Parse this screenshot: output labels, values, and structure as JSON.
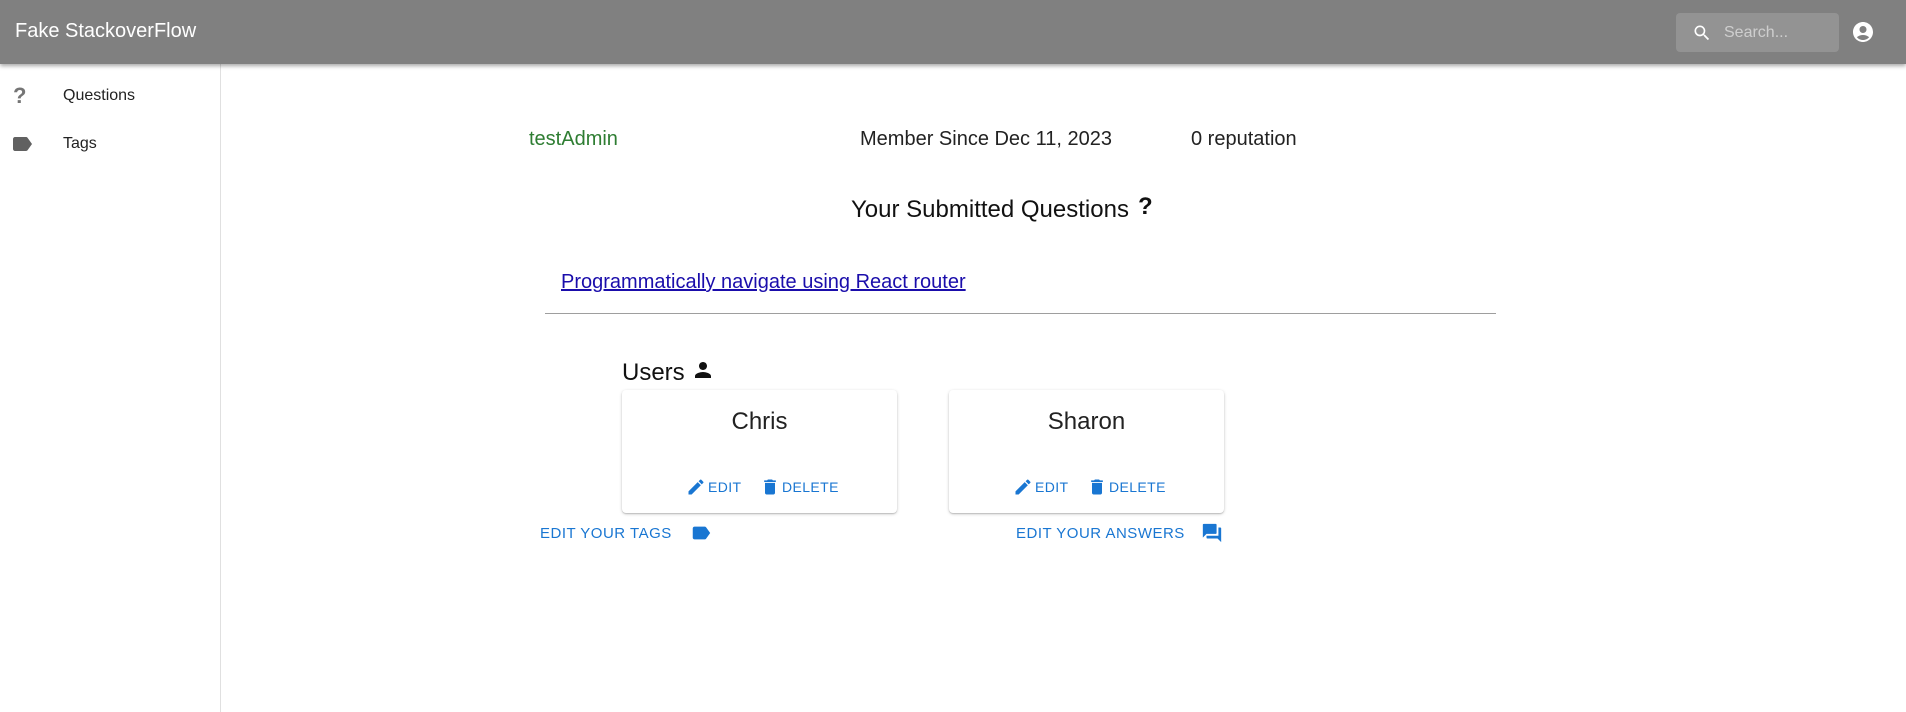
{
  "app": {
    "title": "Fake StackoverFlow"
  },
  "search": {
    "placeholder": "Search..."
  },
  "sidebar": {
    "items": [
      {
        "label": "Questions",
        "icon": "question-mark-icon"
      },
      {
        "label": "Tags",
        "icon": "tag-icon"
      }
    ]
  },
  "profile": {
    "username": "testAdmin",
    "member_since": "Member Since Dec 11, 2023",
    "reputation": "0 reputation"
  },
  "questions_section": {
    "title": "Your Submitted Questions",
    "icon_glyph": "?",
    "questions": [
      {
        "title": "Programmatically navigate using React router"
      }
    ]
  },
  "users_section": {
    "title": "Users",
    "users": [
      {
        "name": "Chris",
        "edit_label": "EDIT",
        "delete_label": "DELETE"
      },
      {
        "name": "Sharon",
        "edit_label": "EDIT",
        "delete_label": "DELETE"
      }
    ]
  },
  "actions": {
    "edit_tags": "EDIT YOUR TAGS",
    "edit_answers": "EDIT YOUR ANSWERS"
  },
  "colors": {
    "appbar": "#808080",
    "accent": "#1976d2",
    "username": "#2e7d32",
    "link": "#1a0dab"
  }
}
